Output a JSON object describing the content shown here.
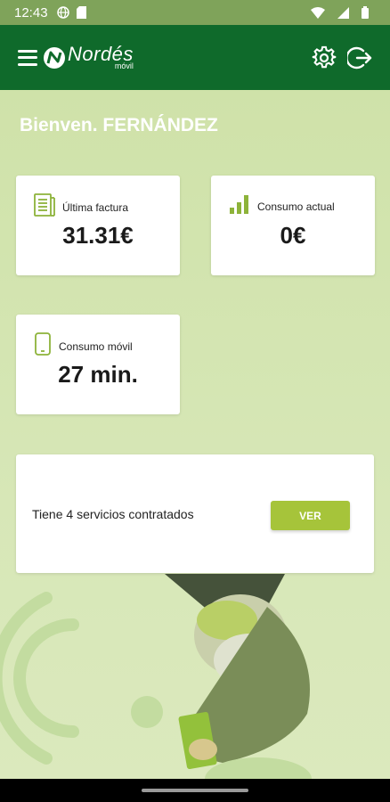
{
  "status_bar": {
    "time": "12:43",
    "icons": [
      "globe-icon",
      "sim-card-icon",
      "wifi-icon",
      "signal-icon",
      "battery-icon"
    ]
  },
  "app_bar": {
    "logo_brand": "Nordés",
    "logo_sub": "móvil",
    "icons": [
      "menu-icon",
      "settings-icon",
      "logout-icon"
    ]
  },
  "welcome": "Bienven. FERNÁNDEZ",
  "cards": {
    "last_invoice": {
      "label": "Última factura",
      "value": "31.31€",
      "icon": "invoice-icon"
    },
    "current_usage": {
      "label": "Consumo actual",
      "value": "0€",
      "icon": "signal-bars-icon"
    },
    "mobile_usage": {
      "label": "Consumo móvil",
      "value": "27 min.",
      "icon": "phone-icon"
    }
  },
  "services": {
    "text": "Tiene 4 servicios contratados",
    "button": "VER"
  },
  "colors": {
    "app_bar": "#0f6a2b",
    "background": "#d6e6b6",
    "accent": "#a6c43a",
    "icon": "#8db33a"
  }
}
